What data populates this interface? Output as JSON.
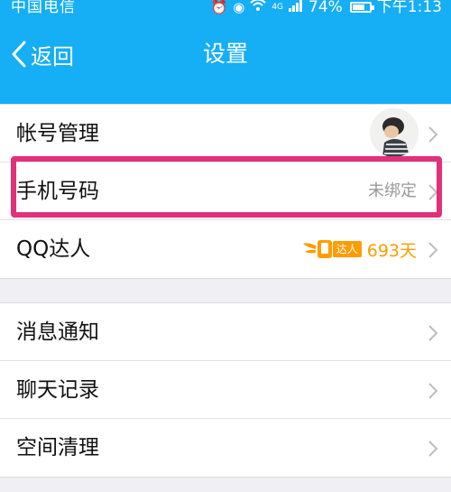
{
  "status_bar": {
    "carrier": "中国电信",
    "network": "4G",
    "battery": "74%",
    "battery_level": 0.74,
    "time": "下午1:13"
  },
  "nav": {
    "back_label": "返回",
    "title": "设置"
  },
  "account_group": [
    {
      "label": "帐号管理"
    },
    {
      "label": "手机号码",
      "value": "未绑定"
    },
    {
      "label": "QQ达人",
      "badge": "达人",
      "days": "693天"
    }
  ],
  "settings_group": [
    {
      "label": "消息通知"
    },
    {
      "label": "聊天记录"
    },
    {
      "label": "空间清理"
    }
  ],
  "colors": {
    "header": "#16aef4",
    "highlight": "#e0317a",
    "talent": "#ff9c00"
  }
}
